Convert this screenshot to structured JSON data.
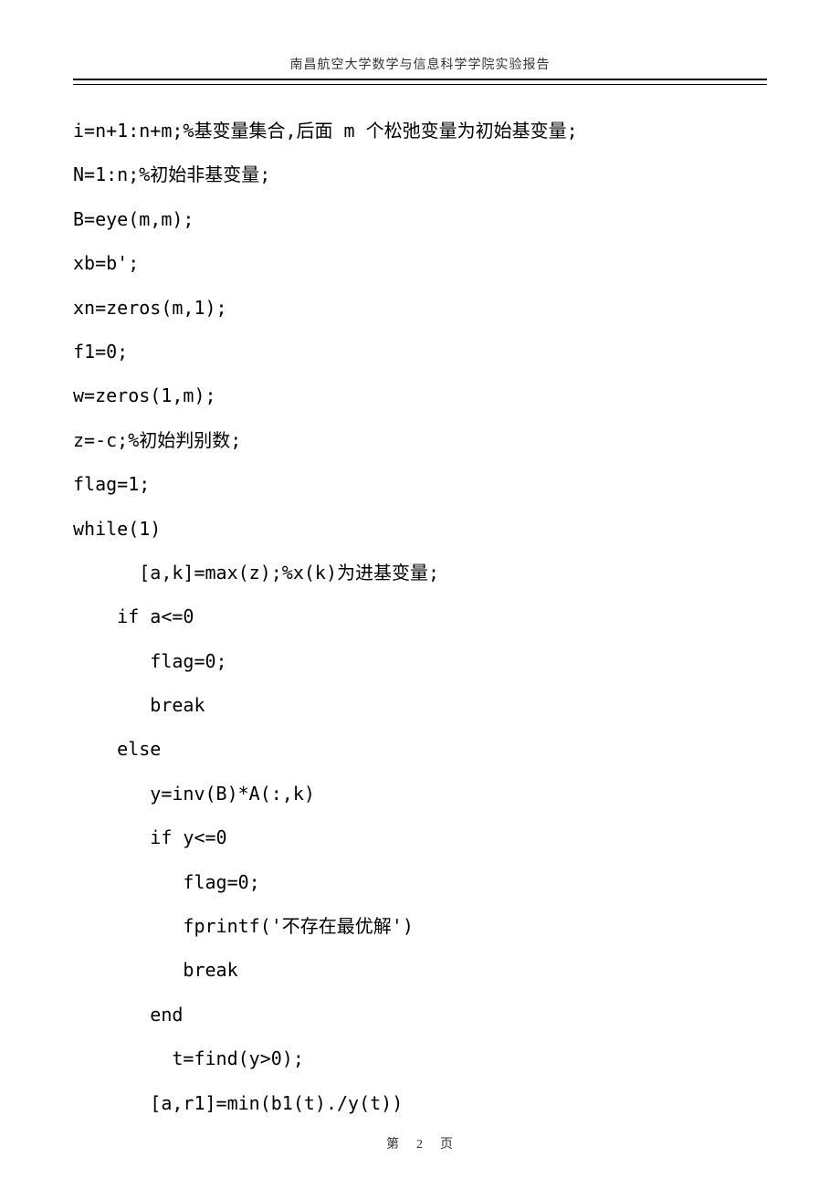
{
  "header": {
    "title": "南昌航空大学数学与信息科学学院实验报告"
  },
  "code": {
    "lines": [
      "i=n+1:n+m;%基变量集合,后面 m 个松弛变量为初始基变量;",
      "N=1:n;%初始非基变量;",
      "B=eye(m,m);",
      "xb=b';",
      "xn=zeros(m,1);",
      "f1=0;",
      "w=zeros(1,m);",
      "z=-c;%初始判别数;",
      "flag=1;",
      "while(1)",
      "      [a,k]=max(z);%x(k)为进基变量;",
      "    if a<=0",
      "       flag=0;",
      "       break",
      "    else",
      "       y=inv(B)*A(:,k)",
      "       if y<=0",
      "          flag=0;",
      "          fprintf('不存在最优解')",
      "          break",
      "       end",
      "         t=find(y>0);",
      "       [a,r1]=min(b1(t)./y(t))"
    ]
  },
  "footer": {
    "left": "第",
    "page": "2",
    "right": "页"
  }
}
